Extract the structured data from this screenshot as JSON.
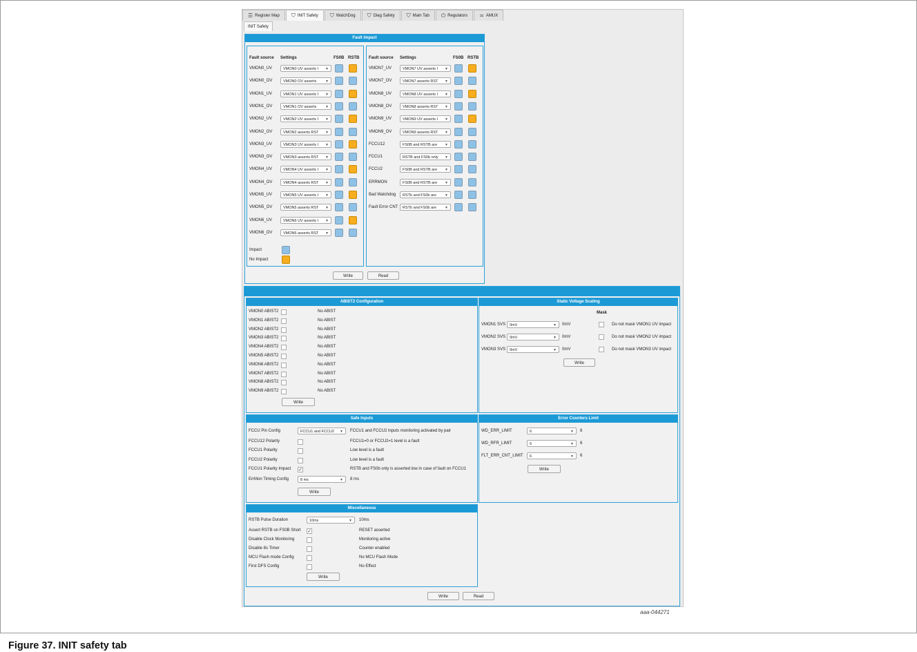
{
  "tabs": [
    {
      "label": "Register Map",
      "icon": "list-icon"
    },
    {
      "label": "INIT Safety",
      "icon": "shield-icon"
    },
    {
      "label": "WatchDog",
      "icon": "shield-icon"
    },
    {
      "label": "Diag Safety",
      "icon": "shield-icon"
    },
    {
      "label": "Main Tab",
      "icon": "shield-icon"
    },
    {
      "label": "Regulators",
      "icon": "power-icon"
    },
    {
      "label": "AMUX",
      "icon": "wave-icon"
    }
  ],
  "subtab": "INIT Safety",
  "fault_impact": {
    "title": "Fault impact",
    "headers": {
      "source": "Fault source",
      "settings": "Settings",
      "fs0b": "FS0B",
      "rstb": "RSTB"
    },
    "left": [
      {
        "source": "VMON0_UV",
        "setting": "VMON0 UV asserts I",
        "fs0b": "blue",
        "rstb": "orange"
      },
      {
        "source": "VMON0_OV",
        "setting": "VMON0 OV asserts",
        "fs0b": "blue",
        "rstb": "blue"
      },
      {
        "source": "VMON1_UV",
        "setting": "VMON1 UV asserts I",
        "fs0b": "blue",
        "rstb": "orange"
      },
      {
        "source": "VMON1_OV",
        "setting": "VMON1 OV asserts",
        "fs0b": "blue",
        "rstb": "blue"
      },
      {
        "source": "VMON2_UV",
        "setting": "VMON2 UV asserts I",
        "fs0b": "blue",
        "rstb": "orange"
      },
      {
        "source": "VMON2_OV",
        "setting": "VMON2 asserts RST",
        "fs0b": "blue",
        "rstb": "blue"
      },
      {
        "source": "VMON3_UV",
        "setting": "VMON3 UV asserts I",
        "fs0b": "blue",
        "rstb": "orange"
      },
      {
        "source": "VMON3_OV",
        "setting": "VMON3 asserts RST",
        "fs0b": "blue",
        "rstb": "blue"
      },
      {
        "source": "VMON4_UV",
        "setting": "VMON4 UV asserts I",
        "fs0b": "blue",
        "rstb": "orange"
      },
      {
        "source": "VMON4_OV",
        "setting": "VMON4 asserts RST",
        "fs0b": "blue",
        "rstb": "blue"
      },
      {
        "source": "VMON5_UV",
        "setting": "VMON5 UV asserts I",
        "fs0b": "blue",
        "rstb": "orange"
      },
      {
        "source": "VMON5_OV",
        "setting": "VMON5 asserts RST",
        "fs0b": "blue",
        "rstb": "blue"
      },
      {
        "source": "VMON6_UV",
        "setting": "VMON6 UV asserts I",
        "fs0b": "blue",
        "rstb": "orange"
      },
      {
        "source": "VMON6_OV",
        "setting": "VMON6 asserts RST",
        "fs0b": "blue",
        "rstb": "blue"
      }
    ],
    "right": [
      {
        "source": "VMON7_UV",
        "setting": "VMON7 UV asserts I",
        "fs0b": "blue",
        "rstb": "orange"
      },
      {
        "source": "VMON7_OV",
        "setting": "VMON7 asserts RST",
        "fs0b": "blue",
        "rstb": "blue"
      },
      {
        "source": "VMON8_UV",
        "setting": "VMON8 UV asserts I",
        "fs0b": "blue",
        "rstb": "orange"
      },
      {
        "source": "VMON8_OV",
        "setting": "VMON8 asserts RST",
        "fs0b": "blue",
        "rstb": "blue"
      },
      {
        "source": "VMON9_UV",
        "setting": "VMON9 UV asserts I",
        "fs0b": "blue",
        "rstb": "orange"
      },
      {
        "source": "VMON9_OV",
        "setting": "VMON9 asserts RST",
        "fs0b": "blue",
        "rstb": "blue"
      },
      {
        "source": "FCCU12",
        "setting": "FS0B and RSTB are",
        "fs0b": "blue",
        "rstb": "blue"
      },
      {
        "source": "FCCU1",
        "setting": "RSTB and FS0b only",
        "fs0b": "blue",
        "rstb": "blue"
      },
      {
        "source": "FCCU2",
        "setting": "FS0B and RSTB are",
        "fs0b": "blue",
        "rstb": "blue"
      },
      {
        "source": "ERRMON",
        "setting": "FS0B and RSTB are",
        "fs0b": "blue",
        "rstb": "blue"
      },
      {
        "source": "Bad Watchdog",
        "setting": "RSTb and FS0b are",
        "fs0b": "blue",
        "rstb": "blue"
      },
      {
        "source": "Fault Error CNT",
        "setting": "RSTb and FS0b are",
        "fs0b": "blue",
        "rstb": "blue"
      }
    ],
    "legend": [
      {
        "label": "Impact",
        "color": "blue"
      },
      {
        "label": "No Impact",
        "color": "orange"
      }
    ],
    "write_label": "Write",
    "read_label": "Read"
  },
  "abist": {
    "title": "ABIST2 Configuration",
    "rows": [
      {
        "label": "VMON0 ABIST2",
        "status": "No ABIST"
      },
      {
        "label": "VMON1 ABIST2",
        "status": "No ABIST"
      },
      {
        "label": "VMON2 ABIST2",
        "status": "No ABIST"
      },
      {
        "label": "VMON3 ABIST2",
        "status": "No ABIST"
      },
      {
        "label": "VMON4 ABIST2",
        "status": "No ABIST"
      },
      {
        "label": "VMON5 ABIST2",
        "status": "No ABIST"
      },
      {
        "label": "VMON6 ABIST2",
        "status": "No ABIST"
      },
      {
        "label": "VMON7 ABIST2",
        "status": "No ABIST"
      },
      {
        "label": "VMON8 ABIST2",
        "status": "No ABIST"
      },
      {
        "label": "VMON9 ABIST2",
        "status": "No ABIST"
      }
    ],
    "write_label": "Write"
  },
  "svs": {
    "title": "Static Voltage Scaling",
    "mask_header": "Mask",
    "rows": [
      {
        "label": "VMON1 SVS",
        "value": "0mV",
        "readout": "0mV",
        "mask": "Do not mask VMON1 UV impact"
      },
      {
        "label": "VMON2 SVS",
        "value": "0mV",
        "readout": "0mV",
        "mask": "Do not mask VMON2 UV impact"
      },
      {
        "label": "VMON3 SVS",
        "value": "0mV",
        "readout": "0mV",
        "mask": "Do not mask VMON3 UV impact"
      }
    ],
    "write_label": "Write"
  },
  "safe_inputs": {
    "title": "Safe Inputs",
    "pin_config": {
      "label": "FCCU Pin Config",
      "value": "FCCU1 and FCCU2",
      "desc": "FCCU1 and FCCU2 inputs monitoring activated by pair"
    },
    "rows": [
      {
        "label": "FCCU12 Polarity",
        "checked": "",
        "desc": "FCCU1=0 or FCCU2=1 level is a fault"
      },
      {
        "label": "FCCU1 Polarity",
        "checked": "",
        "desc": "Low level is a fault"
      },
      {
        "label": "FCCU2 Polarity",
        "checked": "",
        "desc": "Low level is a fault"
      },
      {
        "label": "FCCU1 Polarity Impact",
        "checked": "✓",
        "desc": "RSTB and FS0b only is asserted low in case of fault on FCCU1"
      }
    ],
    "errmon": {
      "label": "ErrMon Timing Config",
      "value": "8 ms",
      "readout": "8 ms"
    },
    "write_label": "Write"
  },
  "err_counters": {
    "title": "Error Counters Limit",
    "rows": [
      {
        "label": "WD_ERR_LIMIT",
        "value": "6",
        "readout": "6"
      },
      {
        "label": "WD_RFR_LIMIT",
        "value": "6",
        "readout": "6"
      },
      {
        "label": "FLT_ERR_CNT_LIMIT",
        "value": "6",
        "readout": "6"
      }
    ],
    "write_label": "Write"
  },
  "misc": {
    "title": "Miscellaneous",
    "rstb": {
      "label": "RSTB Pulse Duration",
      "value": "10ms",
      "readout": "10ms"
    },
    "rows": [
      {
        "label": "Assert RSTB on FS0B Short",
        "checked": "✓",
        "desc": "RESET asserted"
      },
      {
        "label": "Disable Clock Monitoring",
        "checked": "",
        "desc": "Monitoring active"
      },
      {
        "label": "Disable 8s Timer",
        "checked": "",
        "desc": "Counter enabled"
      },
      {
        "label": "MCU Flash mode Config",
        "checked": "",
        "desc": "No MCU Flash Mode"
      },
      {
        "label": "First DFS Config",
        "checked": "",
        "desc": "No Effect"
      }
    ],
    "write_label": "Write"
  },
  "bottom": {
    "write_label": "Write",
    "read_label": "Read"
  },
  "figure_id": "aaa-044271",
  "caption": "Figure 37.  INIT safety tab"
}
